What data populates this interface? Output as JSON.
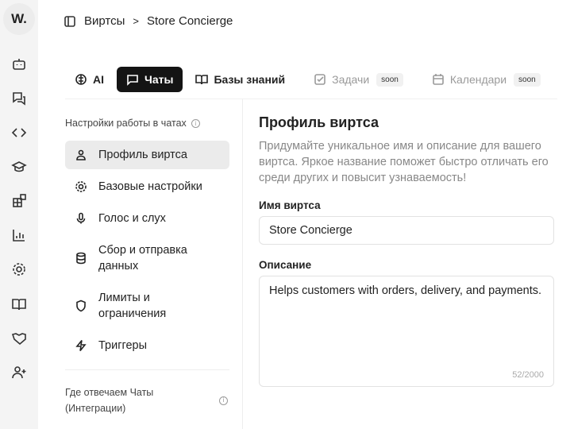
{
  "logo": "W.",
  "breadcrumb": {
    "parent": "Виртсы",
    "current": "Store Concierge"
  },
  "tabs": [
    {
      "label": "AI"
    },
    {
      "label": "Чаты"
    },
    {
      "label": "Базы знаний"
    },
    {
      "label": "Задачи",
      "badge": "soon"
    },
    {
      "label": "Календари",
      "badge": "soon"
    }
  ],
  "settings": {
    "heading": "Настройки работы в чатах",
    "items": [
      {
        "label": "Профиль виртса"
      },
      {
        "label": "Базовые настройки"
      },
      {
        "label": "Голос и слух"
      },
      {
        "label": "Сбор и отправка данных"
      },
      {
        "label": "Лимиты и ограничения"
      },
      {
        "label": "Триггеры"
      }
    ],
    "footer": "Где отвечаем Чаты (Интеграции)"
  },
  "profile": {
    "title": "Профиль виртса",
    "description": "Придумайте уникальное имя и описание для вашего виртса. Яркое название поможет быстро отличать его среди других и повысит узнаваемость!",
    "name_label": "Имя виртса",
    "name_value": "Store Concierge",
    "desc_label": "Описание",
    "desc_value": "Helps customers with orders, delivery, and payments.",
    "counter": "52/2000"
  }
}
